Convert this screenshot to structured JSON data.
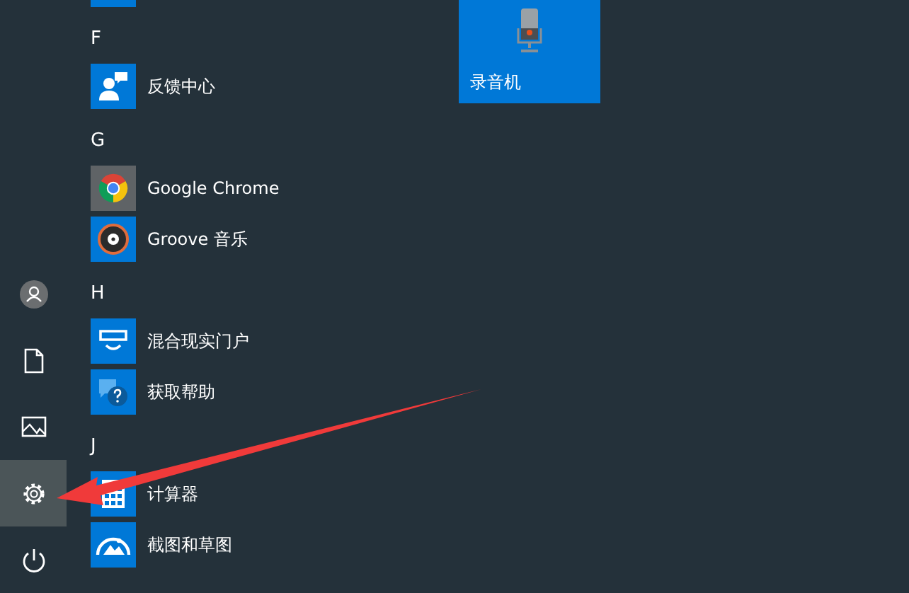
{
  "rail": [
    {
      "kind": "user",
      "selected": false
    },
    {
      "kind": "documents",
      "selected": false
    },
    {
      "kind": "pictures",
      "selected": false
    },
    {
      "kind": "settings",
      "selected": true
    },
    {
      "kind": "power",
      "selected": false
    }
  ],
  "app_list": [
    {
      "kind": "partial"
    },
    {
      "kind": "header",
      "label": "F"
    },
    {
      "kind": "app",
      "label": "反馈中心"
    },
    {
      "kind": "header",
      "label": "G"
    },
    {
      "kind": "app",
      "label": "Google Chrome"
    },
    {
      "kind": "app",
      "label": "Groove 音乐"
    },
    {
      "kind": "header",
      "label": "H"
    },
    {
      "kind": "app",
      "label": "混合现实门户"
    },
    {
      "kind": "app",
      "label": "获取帮助"
    },
    {
      "kind": "header",
      "label": "J"
    },
    {
      "kind": "app",
      "label": "计算器"
    },
    {
      "kind": "app",
      "label": "截图和草图"
    }
  ],
  "tiles": [
    {
      "label": "录音机"
    }
  ]
}
